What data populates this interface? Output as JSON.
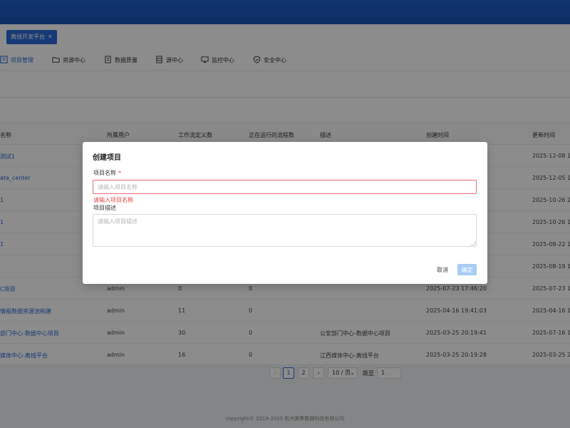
{
  "tabs": [
    {
      "label": "离线开发平台"
    }
  ],
  "nav": {
    "items": [
      {
        "label": "项目管理",
        "icon": "project-icon",
        "active": true
      },
      {
        "label": "资源中心",
        "icon": "folder-icon"
      },
      {
        "label": "数据质量",
        "icon": "quality-icon"
      },
      {
        "label": "源中心",
        "icon": "database-icon"
      },
      {
        "label": "监控中心",
        "icon": "monitor-icon"
      },
      {
        "label": "安全中心",
        "icon": "shield-icon"
      }
    ]
  },
  "table": {
    "headers": [
      "名称",
      "所属用户",
      "工作流定义数",
      "正在运行的流程数",
      "描述",
      "创建时间",
      "更新时间"
    ],
    "rows": [
      {
        "name": "测试1",
        "user": "",
        "defs": "",
        "running": "",
        "desc": "",
        "created": "",
        "updated": "2025-12-08 1"
      },
      {
        "name": "ata_center",
        "user": "",
        "defs": "",
        "running": "",
        "desc": "",
        "created": "",
        "updated": "2025-12-05 1"
      },
      {
        "name": "1",
        "user": "",
        "defs": "",
        "running": "",
        "desc": "",
        "created": "",
        "updated": "2025-10-26 2"
      },
      {
        "name": "1",
        "user": "",
        "defs": "",
        "running": "",
        "desc": "",
        "created": "",
        "updated": "2025-10-26 1"
      },
      {
        "name": "1",
        "user": "",
        "defs": "",
        "running": "",
        "desc": "",
        "created": "",
        "updated": "2025-08-22 1"
      },
      {
        "name": "",
        "user": "",
        "defs": "",
        "running": "",
        "desc": "",
        "created": "",
        "updated": "2025-08-19 1"
      },
      {
        "name": "C项目",
        "user": "admin",
        "defs": "0",
        "running": "0",
        "desc": "",
        "created": "2025-07-23 17:46:20",
        "updated": "2025-07-23 1"
      },
      {
        "name": "情报数据资源池构建",
        "user": "admin",
        "defs": "11",
        "running": "0",
        "desc": "",
        "created": "2025-04-16 19:41:03",
        "updated": "2025-04-16 1"
      },
      {
        "name": "部门中心-数据中心项目",
        "user": "admin",
        "defs": "30",
        "running": "0",
        "desc": "公安部门中心-数据中心项目",
        "created": "2025-03-25 20:19:41",
        "updated": "2025-07-16 1"
      },
      {
        "name": "媒体中心-离线平台",
        "user": "admin",
        "defs": "16",
        "running": "0",
        "desc": "江西媒体中心-离线平台",
        "created": "2025-03-25 20:19:28",
        "updated": "2025-03-25 2"
      }
    ]
  },
  "pager": {
    "prev": "‹",
    "pages": [
      "1",
      "2"
    ],
    "next": "›",
    "page_size": "10 / 页",
    "jump_label": "跳至",
    "jump_value": "1"
  },
  "footer": {
    "text": "copyright© 2019-2025 杭州美擎数据科技有限公司"
  },
  "modal": {
    "title": "创建项目",
    "name_label": "项目名称",
    "required_mark": "*",
    "name_placeholder": "请输入项目名称",
    "name_value": "",
    "name_error": "请输入项目名称",
    "desc_label": "项目描述",
    "desc_placeholder": "请输入项目描述",
    "desc_value": "",
    "cancel": "取消",
    "ok": "确定"
  },
  "colors": {
    "brand": "#1f5fc9",
    "accent": "#2a6ad8",
    "error": "#e54545",
    "ok_disabled": "#a7ccf5"
  }
}
